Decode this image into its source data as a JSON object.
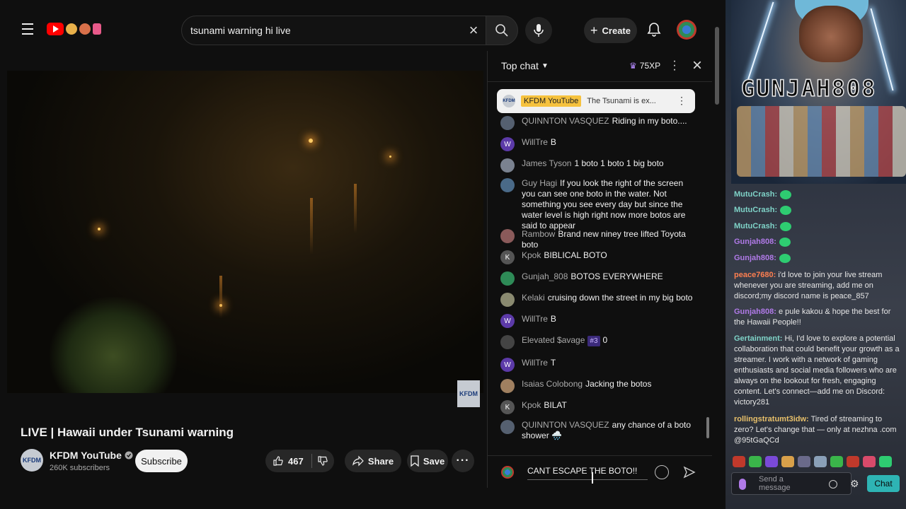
{
  "search": {
    "value": "tsunami warning hi live"
  },
  "header": {
    "create_label": "Create"
  },
  "video": {
    "title": "LIVE | Hawaii under Tsunami warning",
    "channel_name": "KFDM YouTube",
    "subscribers": "260K subscribers",
    "subscribe_label": "Subscribe",
    "like_count": "467",
    "share_label": "Share",
    "save_label": "Save",
    "watermark": "KFDM"
  },
  "chat": {
    "mode_label": "Top chat",
    "xp_label": "75XP",
    "pinned": {
      "author": "KFDM YouTube",
      "message": "The Tsunami is ex..."
    },
    "messages": [
      {
        "author": "QUINNTON VASQUEZ",
        "text": "Riding in my boto....",
        "initial": "",
        "color": "#556070"
      },
      {
        "author": "WillTre",
        "text": "B",
        "initial": "W",
        "color": "#5c3aa8"
      },
      {
        "author": "James Tyson",
        "text": "1 boto 1 boto 1 big boto",
        "initial": "",
        "color": "#7a8290"
      },
      {
        "author": "Guy Hagi",
        "text": "If you look the right of the screen you can see one boto in the water. Not something you see every day but since the water level is high right now more botos are said to appear",
        "initial": "",
        "color": "#4a6a88"
      },
      {
        "author": "Rambow",
        "text": "Brand new niney tree lifted Toyota boto",
        "initial": "",
        "color": "#8a5a5a"
      },
      {
        "author": "Kpok",
        "text": "BIBLICAL BOTO",
        "initial": "K",
        "color": "#555555"
      },
      {
        "author": "Gunjah_808",
        "text": "BOTOS EVERYWHERE",
        "initial": "",
        "color": "#2e8b57"
      },
      {
        "author": "Kelaki",
        "text": "cruising down the street in my big boto",
        "initial": "",
        "color": "#8a8a70"
      },
      {
        "author": "WillTre",
        "text": "B",
        "initial": "W",
        "color": "#5c3aa8"
      },
      {
        "author": "Elevated $avage",
        "badge": "#3",
        "text": "0",
        "initial": "",
        "color": "#444444"
      },
      {
        "author": "WillTre",
        "text": "T",
        "initial": "W",
        "color": "#5c3aa8"
      },
      {
        "author": "Isaias Colobong",
        "text": "Jacking the botos",
        "initial": "",
        "color": "#a08060"
      },
      {
        "author": "Kpok",
        "text": "BILAT",
        "initial": "K",
        "color": "#555555"
      },
      {
        "author": "QUINNTON VASQUEZ",
        "text": "any chance of a boto shower 🌧️",
        "initial": "",
        "color": "#556070"
      }
    ],
    "input_value": "CANT ESCAPE THE BOTO!!"
  },
  "stream": {
    "name": "GUNJAH808",
    "chat": [
      {
        "user": "MutuCrash:",
        "text": "",
        "color": "#7fd3c8"
      },
      {
        "user": "MutuCrash:",
        "text": "",
        "color": "#7fd3c8"
      },
      {
        "user": "MutuCrash:",
        "text": "",
        "color": "#7fd3c8"
      },
      {
        "user": "Gunjah808:",
        "text": "",
        "color": "#b07ae8"
      },
      {
        "user": "Gunjah808:",
        "text": "",
        "color": "#b07ae8"
      },
      {
        "user": "peace7680:",
        "text": "i'd love to join your live stream whenever you are streaming, add me on discord;my discord name is peace_857",
        "color": "#ff7f50"
      },
      {
        "user": "Gunjah808:",
        "text": "e pule kakou & hope the best for the Hawaii People!!",
        "color": "#b07ae8"
      },
      {
        "user": "Gertainment:",
        "text": "Hi, I'd love to explore a potential collaboration that could benefit your growth as a streamer. I work with a network of gaming enthusiasts and social media followers who are always on the lookout for fresh, engaging content. Let's connect—add me on Discord: victory281",
        "color": "#7fd3c8"
      },
      {
        "user": "rollingstratumt3idw:",
        "text": "Tired of streaming to zero? Let's change that — only at nezhna .com @95tGaQCd",
        "color": "#e8c06a"
      }
    ],
    "input_placeholder": "Send a message",
    "chat_button": "Chat"
  }
}
